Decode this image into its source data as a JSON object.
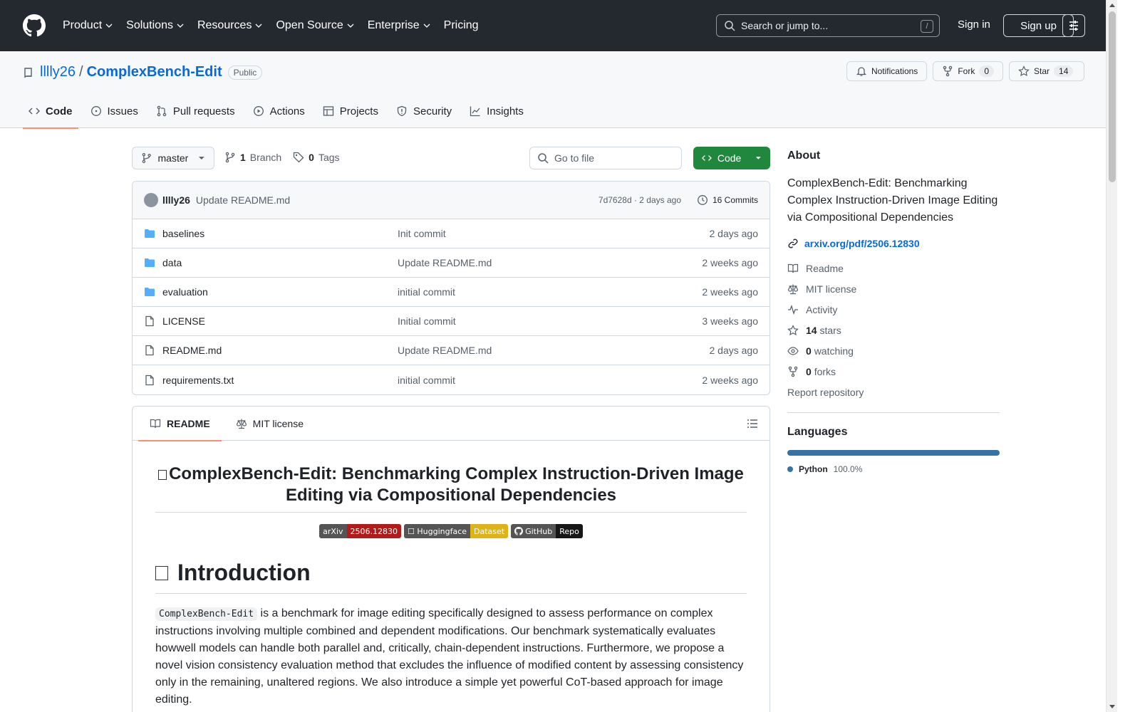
{
  "header": {
    "nav": [
      "Product",
      "Solutions",
      "Resources",
      "Open Source",
      "Enterprise",
      "Pricing"
    ],
    "search_placeholder": "Search or jump to...",
    "search_shortcut": "/",
    "signin": "Sign in",
    "signup": "Sign up"
  },
  "repo": {
    "owner": "lllly26",
    "separator": "/",
    "name": "ComplexBench-Edit",
    "visibility": "Public",
    "notifications": "Notifications",
    "fork_label": "Fork",
    "fork_count": "0",
    "star_label": "Star",
    "star_count": "14",
    "tabs": [
      "Code",
      "Issues",
      "Pull requests",
      "Actions",
      "Projects",
      "Security",
      "Insights"
    ]
  },
  "toolbar": {
    "branch": "master",
    "branch_count": "1",
    "branch_label": "Branch",
    "tag_count": "0",
    "tag_label": "Tags",
    "goto_placeholder": "Go to file",
    "code_button": "Code"
  },
  "commit": {
    "user": "lllly26",
    "message": "Update README.md",
    "meta": "7d7628d · 2 days ago",
    "commits": "16 Commits"
  },
  "files": [
    {
      "name": "baselines",
      "type": "folder",
      "message": "Init commit",
      "date": "2 days ago"
    },
    {
      "name": "data",
      "type": "folder",
      "message": "Update README.md",
      "date": "2 weeks ago"
    },
    {
      "name": "evaluation",
      "type": "folder",
      "message": "initial commit",
      "date": "2 weeks ago"
    },
    {
      "name": "LICENSE",
      "type": "file",
      "message": "Initial commit",
      "date": "3 weeks ago"
    },
    {
      "name": "README.md",
      "type": "file",
      "message": "Update README.md",
      "date": "2 days ago"
    },
    {
      "name": "requirements.txt",
      "type": "file",
      "message": "initial commit",
      "date": "2 weeks ago"
    }
  ],
  "readme": {
    "tab_readme": "README",
    "tab_license": "MIT license",
    "title": "ComplexBench-Edit: Benchmarking Complex Instruction-Driven Image Editing via Compositional Dependencies",
    "badges": [
      {
        "left": "arXiv",
        "right": "2506.12830",
        "left_color": "#555555",
        "right_color": "#b31b1b"
      },
      {
        "left": "☐ Huggingface",
        "right": "Dataset",
        "left_color": "#555555",
        "right_color": "#dfb317"
      },
      {
        "left": "GitHub",
        "right": "Repo",
        "left_color": "#555555",
        "right_color": "#181717"
      }
    ],
    "intro_heading": "Introduction",
    "intro_code": "ComplexBench-Edit",
    "intro_text": " is a benchmark for image editing specifically designed to assess performance on complex instructions involving multiple combined and dependent modifications. Our benchmark systematically evaluates howwell models can handle both parallel and, critically, chain-dependent instructions. Furthermore, we propose a novel vision consistency evaluation method that excludes the influence of modified content by assessing consistency only in the remaining, unaltered regions. We also introduce a simple yet powerful CoT-based approach for image editing."
  },
  "about": {
    "title": "About",
    "description": "ComplexBench-Edit: Benchmarking Complex Instruction-Driven Image Editing via Compositional Dependencies",
    "link": "arxiv.org/pdf/2506.12830",
    "readme": "Readme",
    "license": "MIT license",
    "activity": "Activity",
    "stars_count": "14",
    "stars_label": "stars",
    "watching_count": "0",
    "watching_label": "watching",
    "forks_count": "0",
    "forks_label": "forks",
    "report": "Report repository"
  },
  "languages": {
    "title": "Languages",
    "items": [
      {
        "name": "Python",
        "percent": "100.0%",
        "color": "#3572A5"
      }
    ]
  }
}
